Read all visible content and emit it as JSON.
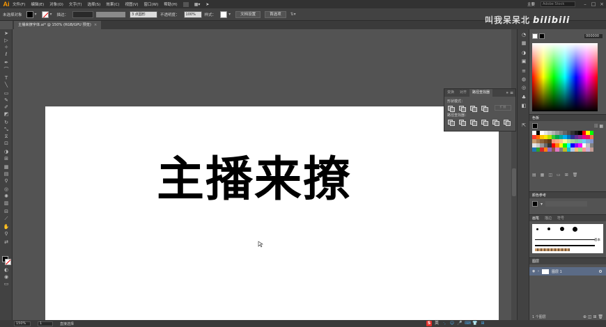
{
  "app": {
    "logo": "Ai"
  },
  "menubar": {
    "items": [
      "文件(F)",
      "编辑(E)",
      "对象(O)",
      "文字(T)",
      "选择(S)",
      "效果(C)",
      "视图(V)",
      "窗口(W)",
      "帮助(H)"
    ],
    "workspace": "主要",
    "search_placeholder": "Adobe Stock"
  },
  "controlbar": {
    "no_selection": "未选择对象",
    "stroke_label": "描边：",
    "brush_value": "3 点圆形",
    "opacity_label": "不透明度：",
    "opacity_value": "100%",
    "style_label": "样式：",
    "doc_setup": "文档设置",
    "preferences": "首选项"
  },
  "document": {
    "tab_title": "主播来撩字体.ai* @ 150% (RGB/GPU 预览)",
    "artwork_text": "主播来撩"
  },
  "watermark": {
    "text": "叫我呆呆北",
    "brand": "bilibili"
  },
  "pathfinder": {
    "tabs": [
      "变换",
      "对齐",
      "路径查找器"
    ],
    "shape_modes_label": "形状模式：",
    "pathfinders_label": "路径查找器：",
    "expand_label": "扩展"
  },
  "color_panel": {
    "hex": "000000"
  },
  "swatches_panel": {
    "title": "色板"
  },
  "color_guide_panel": {
    "title": "颜色参考"
  },
  "brushes_panel": {
    "tabs": [
      "画笔",
      "描边",
      "符号"
    ],
    "basic_label": "基本"
  },
  "layers_panel": {
    "title": "图层",
    "layer_name": "图层 1",
    "footer": "1 个图层"
  },
  "statusbar": {
    "zoom": "150%",
    "page": "1",
    "selection_tool": "直接选择"
  },
  "colors": {
    "swatch_rows": [
      [
        "#ffffff",
        "#000000",
        "#ffffff",
        "#e6e6e6",
        "#cccccc",
        "#b3b3b3",
        "#999999",
        "#808080",
        "#666666",
        "#4d4d4d",
        "#333333",
        "#1a1a1a",
        "#000000",
        "#ff0000",
        "#ffff00",
        "#00ff00"
      ],
      [
        "#ff3b30",
        "#ff6a00",
        "#ffc400",
        "#ffe600",
        "#b4e000",
        "#33cc33",
        "#00a650",
        "#00a99d",
        "#00aeef",
        "#0072bc",
        "#2e3192",
        "#662d91",
        "#92278f",
        "#ec008c",
        "#ed145b",
        "#f26c4f"
      ],
      [
        "#c69c6d",
        "#a67c52",
        "#8c6239",
        "#754c24",
        "#603913",
        "#f7977a",
        "#f9ad81",
        "#fdc68a",
        "#fff79a",
        "#c4df9b",
        "#a3d39c",
        "#82ca9d",
        "#7accc8",
        "#6dcff6",
        "#7da7d9",
        "#8393ca"
      ],
      [
        "#e6e6e6",
        "#cccccc",
        "#999999",
        "#666666",
        "#333333",
        "#ff0000",
        "#ff7f00",
        "#ffff00",
        "#00ff00",
        "#00ffff",
        "#0000ff",
        "#8b00ff",
        "#ff00ff",
        "#ffffff",
        "#c0c0c0",
        "#808080"
      ],
      [
        "#1f77b4",
        "#2ca02c",
        "#d62728",
        "#ff7f0e",
        "#9467bd",
        "#8c564b",
        "#e377c2",
        "#7f7f7f",
        "#bcbd22",
        "#17becf",
        "#aec7e8",
        "#ffbb78",
        "#98df8a",
        "#ff9896",
        "#c5b0d5",
        "#c49c94"
      ]
    ]
  }
}
